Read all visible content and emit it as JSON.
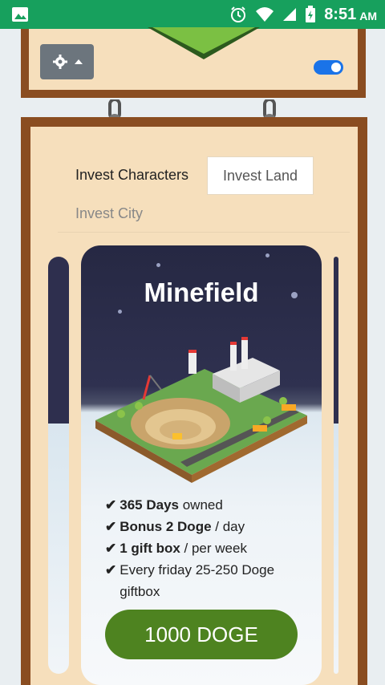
{
  "status_bar": {
    "time": "8:51",
    "ampm": "AM"
  },
  "tabs": {
    "invest_characters": "Invest Characters",
    "invest_land": "Invest Land",
    "invest_city": "Invest City"
  },
  "card": {
    "title": "Minefield",
    "features": [
      {
        "bold": "365 Days",
        "rest": " owned"
      },
      {
        "bold": "Bonus 2 Doge",
        "rest": " / day"
      },
      {
        "bold": "1 gift box",
        "rest": " / per week"
      },
      {
        "bold": "",
        "rest": "Every friday 25-250 Doge giftbox"
      }
    ],
    "button_label": "1000 DOGE"
  },
  "toggle": {
    "enabled": true
  },
  "colors": {
    "status_bar": "#17a05d",
    "wood": "#8a4d21",
    "panel": "#f6dfbc",
    "buy_button": "#4e8320",
    "toggle": "#1a73e8"
  },
  "icons": [
    "image-icon",
    "alarm-icon",
    "wifi-icon",
    "signal-icon",
    "battery-icon",
    "gear-icon",
    "caret-up-icon",
    "check-icon"
  ]
}
